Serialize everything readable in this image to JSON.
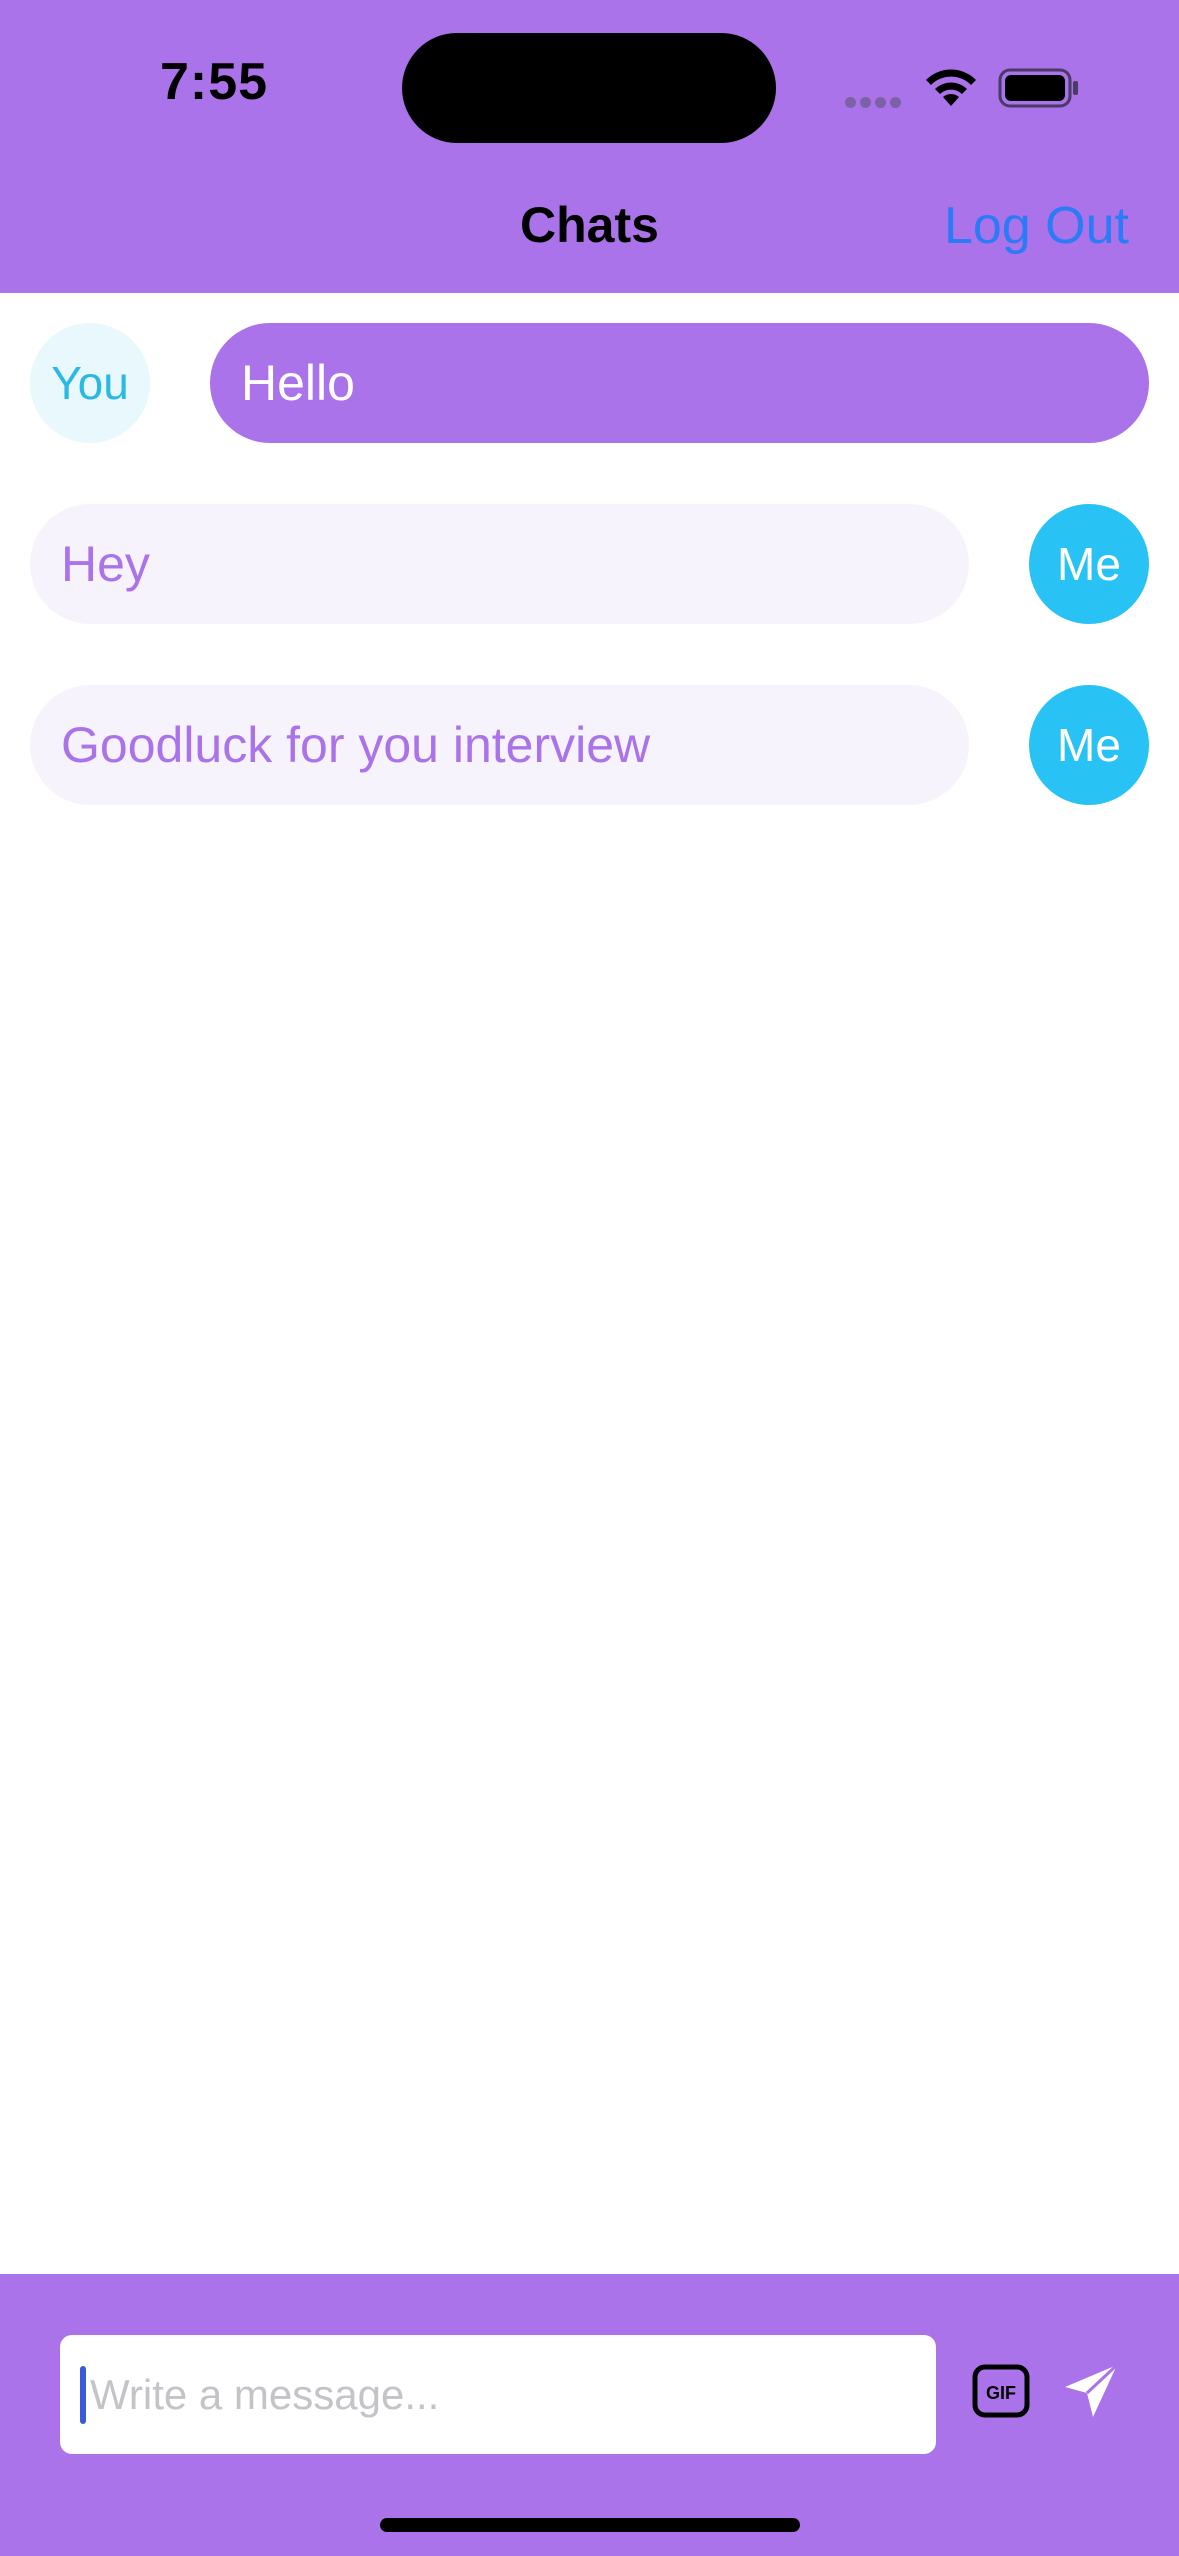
{
  "status_bar": {
    "time": "7:55"
  },
  "nav": {
    "title": "Chats",
    "logout_label": "Log Out"
  },
  "messages": [
    {
      "sender": "You",
      "text": "Hello"
    },
    {
      "sender": "Me",
      "text": "Hey"
    },
    {
      "sender": "Me",
      "text": "Goodluck for you interview"
    }
  ],
  "composer": {
    "placeholder": "Write a message...",
    "value": ""
  },
  "icons": {
    "wifi": "wifi-icon",
    "battery": "battery-icon",
    "gif": "gif-icon",
    "send": "send-icon"
  },
  "colors": {
    "accent": "#ab73ea",
    "link": "#2a7bf6",
    "me_avatar": "#29c2f5",
    "you_avatar_bg": "#e8f8fc",
    "outgoing_bubble_bg": "#f7f3fc"
  }
}
